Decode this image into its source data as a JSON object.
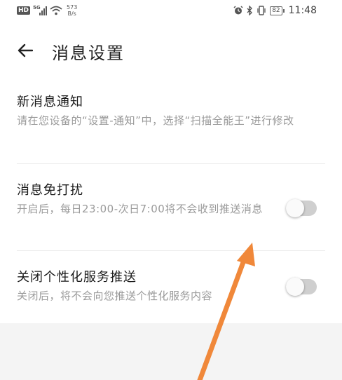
{
  "status_bar": {
    "network_badge": "HD",
    "signal_label": "5G",
    "speed_value": "573",
    "speed_unit": "B/s",
    "battery": "82",
    "time": "11:48"
  },
  "header": {
    "title": "消息设置"
  },
  "settings": [
    {
      "title": "新消息通知",
      "description": "请在您设备的“设置-通知”中，选择“扫描全能王”进行修改",
      "has_toggle": false
    },
    {
      "title": "消息免打扰",
      "description": "开启后，每日23:00-次日7:00将不会收到推送消息",
      "has_toggle": true,
      "enabled": false
    },
    {
      "title": "关闭个性化服务推送",
      "description": "关闭后，将不会向您推送个性化服务内容",
      "has_toggle": true,
      "enabled": false
    }
  ],
  "colors": {
    "annotation_arrow": "#f0883a",
    "toggle_off": "#cfcfcf",
    "secondary_text": "#9a9a9a"
  }
}
